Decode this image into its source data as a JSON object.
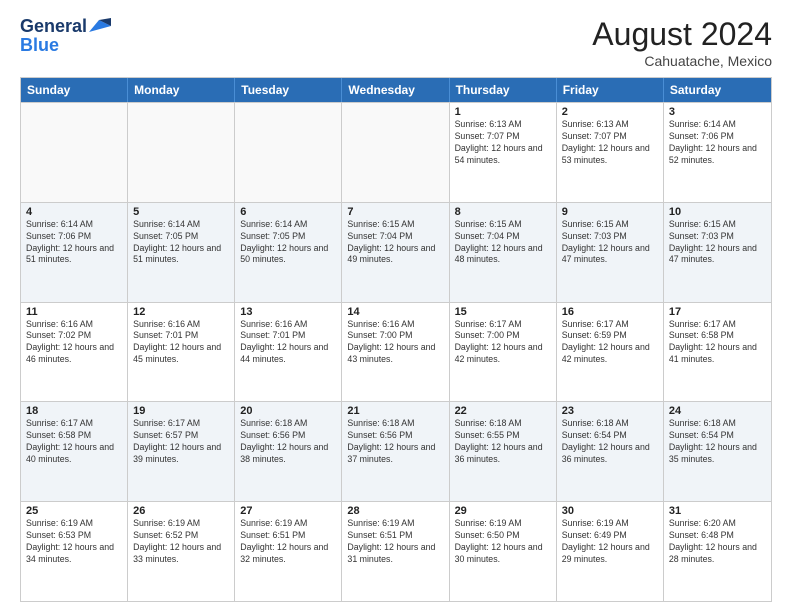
{
  "header": {
    "logo_general": "General",
    "logo_blue": "Blue",
    "month_year": "August 2024",
    "location": "Cahuatache, Mexico"
  },
  "days_of_week": [
    "Sunday",
    "Monday",
    "Tuesday",
    "Wednesday",
    "Thursday",
    "Friday",
    "Saturday"
  ],
  "weeks": [
    [
      {
        "day": "",
        "sunrise": "",
        "sunset": "",
        "daylight": "",
        "empty": true
      },
      {
        "day": "",
        "sunrise": "",
        "sunset": "",
        "daylight": "",
        "empty": true
      },
      {
        "day": "",
        "sunrise": "",
        "sunset": "",
        "daylight": "",
        "empty": true
      },
      {
        "day": "",
        "sunrise": "",
        "sunset": "",
        "daylight": "",
        "empty": true
      },
      {
        "day": "1",
        "sunrise": "Sunrise: 6:13 AM",
        "sunset": "Sunset: 7:07 PM",
        "daylight": "Daylight: 12 hours and 54 minutes.",
        "empty": false
      },
      {
        "day": "2",
        "sunrise": "Sunrise: 6:13 AM",
        "sunset": "Sunset: 7:07 PM",
        "daylight": "Daylight: 12 hours and 53 minutes.",
        "empty": false
      },
      {
        "day": "3",
        "sunrise": "Sunrise: 6:14 AM",
        "sunset": "Sunset: 7:06 PM",
        "daylight": "Daylight: 12 hours and 52 minutes.",
        "empty": false
      }
    ],
    [
      {
        "day": "4",
        "sunrise": "Sunrise: 6:14 AM",
        "sunset": "Sunset: 7:06 PM",
        "daylight": "Daylight: 12 hours and 51 minutes.",
        "empty": false
      },
      {
        "day": "5",
        "sunrise": "Sunrise: 6:14 AM",
        "sunset": "Sunset: 7:05 PM",
        "daylight": "Daylight: 12 hours and 51 minutes.",
        "empty": false
      },
      {
        "day": "6",
        "sunrise": "Sunrise: 6:14 AM",
        "sunset": "Sunset: 7:05 PM",
        "daylight": "Daylight: 12 hours and 50 minutes.",
        "empty": false
      },
      {
        "day": "7",
        "sunrise": "Sunrise: 6:15 AM",
        "sunset": "Sunset: 7:04 PM",
        "daylight": "Daylight: 12 hours and 49 minutes.",
        "empty": false
      },
      {
        "day": "8",
        "sunrise": "Sunrise: 6:15 AM",
        "sunset": "Sunset: 7:04 PM",
        "daylight": "Daylight: 12 hours and 48 minutes.",
        "empty": false
      },
      {
        "day": "9",
        "sunrise": "Sunrise: 6:15 AM",
        "sunset": "Sunset: 7:03 PM",
        "daylight": "Daylight: 12 hours and 47 minutes.",
        "empty": false
      },
      {
        "day": "10",
        "sunrise": "Sunrise: 6:15 AM",
        "sunset": "Sunset: 7:03 PM",
        "daylight": "Daylight: 12 hours and 47 minutes.",
        "empty": false
      }
    ],
    [
      {
        "day": "11",
        "sunrise": "Sunrise: 6:16 AM",
        "sunset": "Sunset: 7:02 PM",
        "daylight": "Daylight: 12 hours and 46 minutes.",
        "empty": false
      },
      {
        "day": "12",
        "sunrise": "Sunrise: 6:16 AM",
        "sunset": "Sunset: 7:01 PM",
        "daylight": "Daylight: 12 hours and 45 minutes.",
        "empty": false
      },
      {
        "day": "13",
        "sunrise": "Sunrise: 6:16 AM",
        "sunset": "Sunset: 7:01 PM",
        "daylight": "Daylight: 12 hours and 44 minutes.",
        "empty": false
      },
      {
        "day": "14",
        "sunrise": "Sunrise: 6:16 AM",
        "sunset": "Sunset: 7:00 PM",
        "daylight": "Daylight: 12 hours and 43 minutes.",
        "empty": false
      },
      {
        "day": "15",
        "sunrise": "Sunrise: 6:17 AM",
        "sunset": "Sunset: 7:00 PM",
        "daylight": "Daylight: 12 hours and 42 minutes.",
        "empty": false
      },
      {
        "day": "16",
        "sunrise": "Sunrise: 6:17 AM",
        "sunset": "Sunset: 6:59 PM",
        "daylight": "Daylight: 12 hours and 42 minutes.",
        "empty": false
      },
      {
        "day": "17",
        "sunrise": "Sunrise: 6:17 AM",
        "sunset": "Sunset: 6:58 PM",
        "daylight": "Daylight: 12 hours and 41 minutes.",
        "empty": false
      }
    ],
    [
      {
        "day": "18",
        "sunrise": "Sunrise: 6:17 AM",
        "sunset": "Sunset: 6:58 PM",
        "daylight": "Daylight: 12 hours and 40 minutes.",
        "empty": false
      },
      {
        "day": "19",
        "sunrise": "Sunrise: 6:17 AM",
        "sunset": "Sunset: 6:57 PM",
        "daylight": "Daylight: 12 hours and 39 minutes.",
        "empty": false
      },
      {
        "day": "20",
        "sunrise": "Sunrise: 6:18 AM",
        "sunset": "Sunset: 6:56 PM",
        "daylight": "Daylight: 12 hours and 38 minutes.",
        "empty": false
      },
      {
        "day": "21",
        "sunrise": "Sunrise: 6:18 AM",
        "sunset": "Sunset: 6:56 PM",
        "daylight": "Daylight: 12 hours and 37 minutes.",
        "empty": false
      },
      {
        "day": "22",
        "sunrise": "Sunrise: 6:18 AM",
        "sunset": "Sunset: 6:55 PM",
        "daylight": "Daylight: 12 hours and 36 minutes.",
        "empty": false
      },
      {
        "day": "23",
        "sunrise": "Sunrise: 6:18 AM",
        "sunset": "Sunset: 6:54 PM",
        "daylight": "Daylight: 12 hours and 36 minutes.",
        "empty": false
      },
      {
        "day": "24",
        "sunrise": "Sunrise: 6:18 AM",
        "sunset": "Sunset: 6:54 PM",
        "daylight": "Daylight: 12 hours and 35 minutes.",
        "empty": false
      }
    ],
    [
      {
        "day": "25",
        "sunrise": "Sunrise: 6:19 AM",
        "sunset": "Sunset: 6:53 PM",
        "daylight": "Daylight: 12 hours and 34 minutes.",
        "empty": false
      },
      {
        "day": "26",
        "sunrise": "Sunrise: 6:19 AM",
        "sunset": "Sunset: 6:52 PM",
        "daylight": "Daylight: 12 hours and 33 minutes.",
        "empty": false
      },
      {
        "day": "27",
        "sunrise": "Sunrise: 6:19 AM",
        "sunset": "Sunset: 6:51 PM",
        "daylight": "Daylight: 12 hours and 32 minutes.",
        "empty": false
      },
      {
        "day": "28",
        "sunrise": "Sunrise: 6:19 AM",
        "sunset": "Sunset: 6:51 PM",
        "daylight": "Daylight: 12 hours and 31 minutes.",
        "empty": false
      },
      {
        "day": "29",
        "sunrise": "Sunrise: 6:19 AM",
        "sunset": "Sunset: 6:50 PM",
        "daylight": "Daylight: 12 hours and 30 minutes.",
        "empty": false
      },
      {
        "day": "30",
        "sunrise": "Sunrise: 6:19 AM",
        "sunset": "Sunset: 6:49 PM",
        "daylight": "Daylight: 12 hours and 29 minutes.",
        "empty": false
      },
      {
        "day": "31",
        "sunrise": "Sunrise: 6:20 AM",
        "sunset": "Sunset: 6:48 PM",
        "daylight": "Daylight: 12 hours and 28 minutes.",
        "empty": false
      }
    ]
  ]
}
